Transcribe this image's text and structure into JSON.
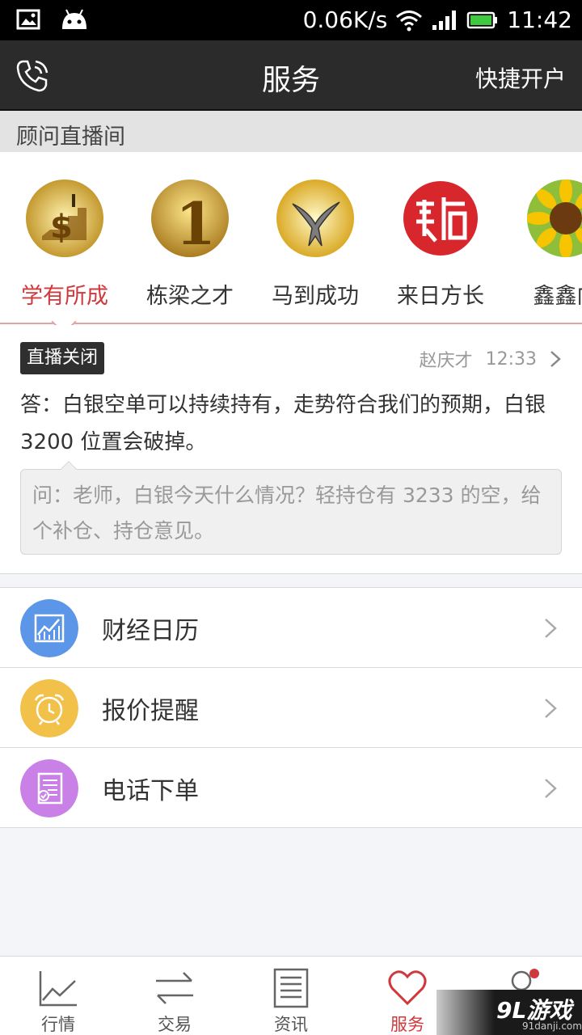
{
  "status_bar": {
    "speed": "0.06K/s",
    "time": "11:42",
    "icons": [
      "image-icon",
      "android-icon",
      "wifi-icon",
      "signal-icon",
      "battery-icon"
    ]
  },
  "header": {
    "title": "服务",
    "right_action": "快捷开户",
    "left_icon": "phone-icon"
  },
  "advisor_section": {
    "title": "顾问直播间",
    "advisors": [
      {
        "name": "学有所成",
        "active": true
      },
      {
        "name": "栋梁之才",
        "active": false
      },
      {
        "name": "马到成功",
        "active": false
      },
      {
        "name": "来日方长",
        "active": false
      },
      {
        "name": "鑫鑫向",
        "active": false
      }
    ]
  },
  "live": {
    "badge": "直播关闭",
    "author": "赵庆才",
    "time": "12:33",
    "answer": "答：白银空单可以持续持有，走势符合我们的预期，白银3200 位置会破掉。",
    "question": "问：老师，白银今天什么情况？轻持仓有 3233 的空，给个补仓、持仓意见。"
  },
  "menu": [
    {
      "label": "财经日历",
      "icon": "chart-icon",
      "color": "#5b96e8"
    },
    {
      "label": "报价提醒",
      "icon": "alarm-clock-icon",
      "color": "#f2c14a"
    },
    {
      "label": "电话下单",
      "icon": "document-check-icon",
      "color": "#c981e8"
    }
  ],
  "tabs": [
    {
      "label": "行情",
      "icon": "trend-icon"
    },
    {
      "label": "交易",
      "icon": "exchange-icon"
    },
    {
      "label": "资讯",
      "icon": "news-icon"
    },
    {
      "label": "服务",
      "icon": "heart-icon",
      "active": true
    },
    {
      "label": "",
      "icon": "user-icon"
    }
  ],
  "accent_color": "#d0393c",
  "watermark": {
    "logo": "9L游戏",
    "url": "91danji.com"
  }
}
